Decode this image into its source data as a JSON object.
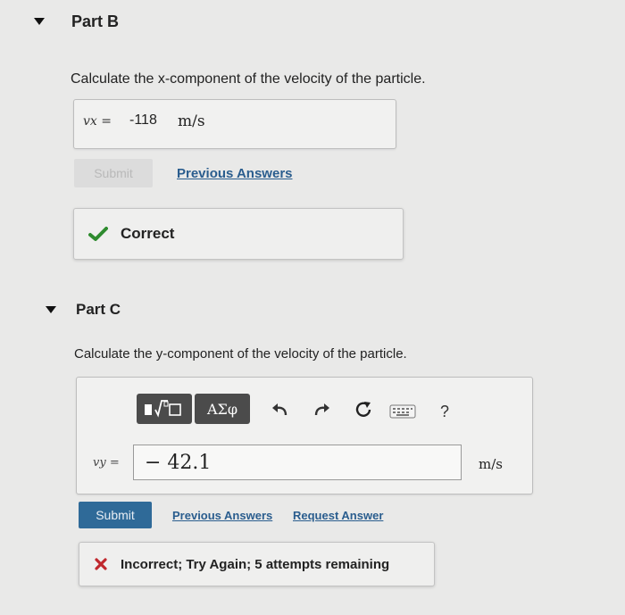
{
  "part_b": {
    "title": "Part B",
    "question": "Calculate the x-component of the velocity of the particle.",
    "answer_label": "vx =",
    "answer_value": "-118",
    "answer_unit": "m/s",
    "submit_label": "Submit",
    "previous_answers_label": "Previous Answers",
    "feedback": "Correct"
  },
  "part_c": {
    "title": "Part C",
    "question": "Calculate the y-component of the velocity of the particle.",
    "toolbar": {
      "symbols_label": "ΑΣφ",
      "help_label": "?"
    },
    "answer_label": "vy =",
    "answer_value": "− 42.1",
    "answer_unit": "m/s",
    "submit_label": "Submit",
    "previous_answers_label": "Previous Answers",
    "request_answer_label": "Request Answer",
    "feedback": "Incorrect; Try Again; 5 attempts remaining"
  },
  "colors": {
    "correct": "#2e8b2e",
    "incorrect": "#c0282d",
    "submit": "#2f6a98",
    "link": "#2a5d8e"
  }
}
